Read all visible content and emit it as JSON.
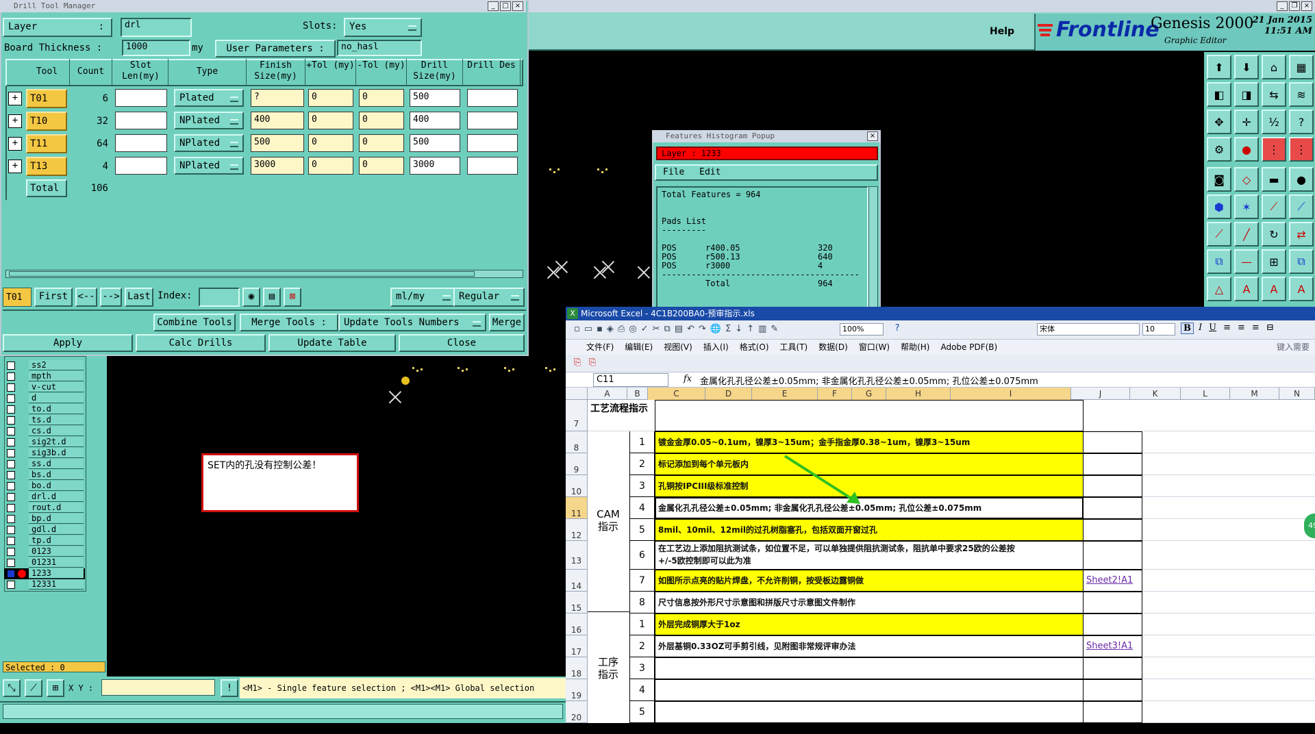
{
  "dtm": {
    "title": "Drill Tool Manager",
    "layer_label": "Layer",
    "layer_value": "drl",
    "slots_label": "Slots:",
    "slots_value": "Yes",
    "board_thickness_label": "Board Thickness",
    "board_thickness_value": "1000",
    "board_thickness_unit": "my",
    "user_params_label": "User Parameters",
    "user_params_value": "no_hasl",
    "columns": [
      "Tool",
      "Count",
      "Slot Len(my)",
      "Type",
      "Finish Size(my)",
      "+Tol (my)",
      "-Tol (my)",
      "Drill Size(my)",
      "Drill Des"
    ],
    "rows": [
      {
        "tool": "T01",
        "count": "6",
        "type": "Plated",
        "finish": "?",
        "ptol": "0",
        "ntol": "0",
        "drill": "500"
      },
      {
        "tool": "T10",
        "count": "32",
        "type": "NPlated",
        "finish": "400",
        "ptol": "0",
        "ntol": "0",
        "drill": "400"
      },
      {
        "tool": "T11",
        "count": "64",
        "type": "NPlated",
        "finish": "500",
        "ptol": "0",
        "ntol": "0",
        "drill": "500"
      },
      {
        "tool": "T13",
        "count": "4",
        "type": "NPlated",
        "finish": "3000",
        "ptol": "0",
        "ntol": "0",
        "drill": "3000"
      }
    ],
    "total_label": "Total",
    "total_count": "106",
    "current_tool": "T01",
    "nav": {
      "first": "First",
      "prev": "<--",
      "next": "-->",
      "last": "Last",
      "index": "Index:"
    },
    "unit_select": "ml/my",
    "mode_select": "Regular",
    "actions1": {
      "combine": "Combine Tools",
      "merge_tools": "Merge Tools :",
      "update_numbers": "Update Tools Numbers",
      "merge": "Merge"
    },
    "actions2": {
      "apply": "Apply",
      "calc": "Calc Drills",
      "update_table": "Update Table",
      "close": "Close"
    }
  },
  "genesis": {
    "help": "Help",
    "brand": "Frontline",
    "product": "Genesis 2000",
    "subtitle": "Graphic Editor",
    "date": "21 Jan 2015",
    "time": "11:51 AM"
  },
  "layers": [
    "ss2",
    "mpth",
    "v-cut",
    "d",
    "to.d",
    "ts.d",
    "cs.d",
    "sig2t.d",
    "sig3b.d",
    "ss.d",
    "bs.d",
    "bo.d",
    "drl.d",
    "rout.d",
    "bp.d",
    "gdl.d",
    "tp.d",
    "0123",
    "01231",
    "1233",
    "12331"
  ],
  "selected_label": "Selected : 0",
  "xy_label": "X Y :",
  "status_message": "<M1> - Single feature selection ; <M1><M1> Global selection",
  "warning_note": "SET内的孔没有控制公差！",
  "histogram": {
    "title": "Features Histogram Popup",
    "layer": "Layer :  1233",
    "menu": [
      "File",
      "Edit"
    ],
    "total": "Total Features = 964",
    "section": "Pads List",
    "underline": "---------",
    "entries": [
      {
        "kind": "POS",
        "sym": "r400.05",
        "n": "320"
      },
      {
        "kind": "POS",
        "sym": "r500.13",
        "n": "640"
      },
      {
        "kind": "POS",
        "sym": "r3000",
        "n": "4"
      }
    ],
    "separator": "----------------------------------------",
    "total_row": {
      "label": "Total",
      "n": "964"
    }
  },
  "excel": {
    "title": "Microsoft Excel - 4C1B200BA0-预审指示.xls",
    "menu": [
      "文件(F)",
      "编辑(E)",
      "视图(V)",
      "插入(I)",
      "格式(O)",
      "工具(T)",
      "数据(D)",
      "窗口(W)",
      "帮助(H)",
      "Adobe PDF(B)"
    ],
    "help_placeholder": "键入需要",
    "zoom": "100%",
    "font": "宋体",
    "size": "10",
    "name_box": "C11",
    "fx": "fx",
    "formula": "金属化孔孔径公差±0.05mm; 非金属化孔孔径公差±0.05mm; 孔位公差±0.075mm",
    "columns": [
      "A",
      "B",
      "C",
      "D",
      "E",
      "F",
      "G",
      "H",
      "I",
      "J",
      "K",
      "L",
      "M",
      "N"
    ],
    "header_row": {
      "row": "7",
      "a": "工艺流程指示"
    },
    "group_cam": "CAM指示",
    "group_process": "工序指示",
    "rows": [
      {
        "row": "8",
        "b": "1",
        "text": "镀金金厚0.05~0.1um，镍厚3~15um；金手指金厚0.38~1um，镍厚3~15um",
        "hl": true,
        "link": ""
      },
      {
        "row": "9",
        "b": "2",
        "text": "标记添加到每个单元板内",
        "hl": true,
        "link": ""
      },
      {
        "row": "10",
        "b": "3",
        "text": "孔铜按IPCIII级标准控制",
        "hl": true,
        "link": ""
      },
      {
        "row": "11",
        "b": "4",
        "text": "金属化孔孔径公差±0.05mm; 非金属化孔孔径公差±0.05mm; 孔位公差±0.075mm",
        "hl": false,
        "link": ""
      },
      {
        "row": "12",
        "b": "5",
        "text": "8mil、10mil、12mil的过孔树脂塞孔，包括双面开窗过孔",
        "hl": true,
        "link": ""
      },
      {
        "row": "13",
        "b": "6",
        "text": "在工艺边上添加阻抗测试条，如位置不足，可以单独提供阻抗测试条，阻抗单中要求25欧的公差按",
        "text2": "+/-5欧控制即可以此为准",
        "hl": false,
        "link": ""
      },
      {
        "row": "14",
        "b": "7",
        "text": "如图所示点亮的贴片焊盘，不允许削铜，按受板边露铜做",
        "hl": true,
        "link": "Sheet2!A1"
      },
      {
        "row": "15",
        "b": "8",
        "text": "尺寸信息按外形尺寸示意图和拼版尺寸示意图文件制作",
        "hl": false,
        "link": ""
      },
      {
        "row": "16",
        "b": "1",
        "text": "外层完成铜厚大于1oz",
        "hl": true,
        "link": ""
      },
      {
        "row": "17",
        "b": "2",
        "text": "外层基铜0.33OZ可手剪引线，见附图非常规评审办法",
        "hl": false,
        "link": "Sheet3!A1"
      },
      {
        "row": "18",
        "b": "3",
        "text": "",
        "hl": false,
        "link": ""
      },
      {
        "row": "19",
        "b": "4",
        "text": "",
        "hl": false,
        "link": ""
      },
      {
        "row": "20",
        "b": "5",
        "text": "",
        "hl": false,
        "link": ""
      }
    ],
    "side_badge": "49"
  },
  "colors": {
    "teal": "#6fcfbd",
    "button_yellow": "#f4c743",
    "excel_highlight": "#ffff00",
    "layer_red": "#ff0000"
  }
}
